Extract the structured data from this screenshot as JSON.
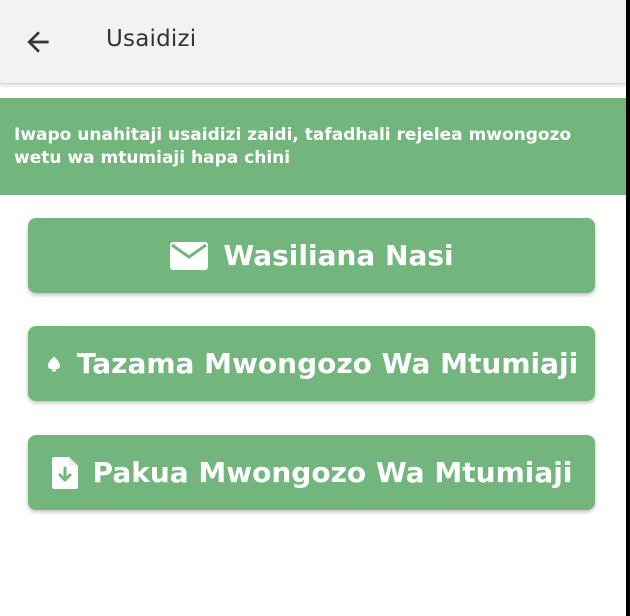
{
  "header": {
    "title": "Usaidizi",
    "back_icon": "arrow-left-icon"
  },
  "info": {
    "text": "Iwapo unahitaji usaidizi zaidi, tafadhali rejelea mwongozo wetu wa mtumiaji hapa chini"
  },
  "actions": [
    {
      "label": "Wasiliana Nasi",
      "icon": "mail-icon"
    },
    {
      "label": "Tazama Mwongozo Wa Mtumiaji",
      "icon": "spade-icon"
    },
    {
      "label": "Pakua Mwongozo Wa Mtumiaji",
      "icon": "download-file-icon"
    }
  ],
  "colors": {
    "accent": "#72b57d",
    "app_bar": "#f2f2f2",
    "text_dark": "#333333"
  }
}
